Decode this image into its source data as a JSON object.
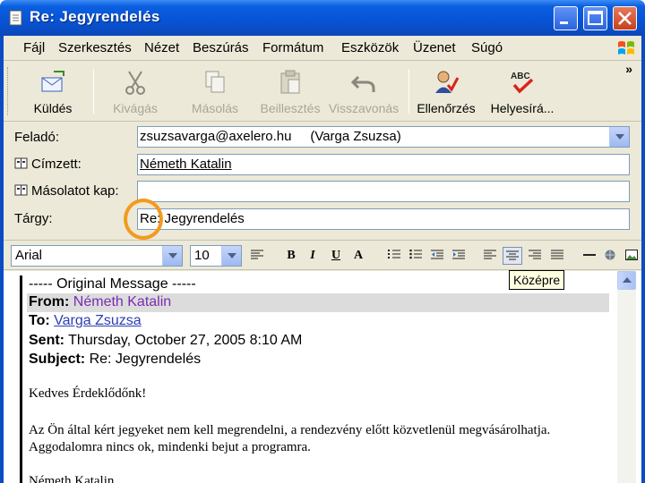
{
  "window": {
    "title": "Re: Jegyrendelés"
  },
  "menu": [
    "Fájl",
    "Szerkesztés",
    "Nézet",
    "Beszúrás",
    "Formátum",
    "Eszközök",
    "Üzenet",
    "Súgó"
  ],
  "toolbar": {
    "send": "Küldés",
    "cut": "Kivágás",
    "copy": "Másolás",
    "paste": "Beillesztés",
    "undo": "Visszavonás",
    "check": "Ellenőrzés",
    "spelling": "Helyesírá...",
    "more": "»"
  },
  "header": {
    "from_label": "Feladó:",
    "from_value": "zsuzsavarga@axelero.hu     (Varga Zsuzsa)",
    "to_label": "Címzett:",
    "to_value": "Németh Katalin",
    "cc_label": "Másolatot kap:",
    "cc_value": "",
    "subject_label": "Tárgy:",
    "subject_value": "Re: Jegyrendelés"
  },
  "format": {
    "font": "Arial",
    "size": "10",
    "bold": "B",
    "italic": "I",
    "underline": "U",
    "font_color": "A",
    "tooltip": "Középre"
  },
  "message": {
    "original_header": "----- Original Message -----",
    "from_label": "From:",
    "from_value": "Németh Katalin",
    "to_label": "To:",
    "to_value": "Varga Zsuzsa",
    "sent_label": "Sent:",
    "sent_value": "Thursday, October 27, 2005 8:10 AM",
    "subject_label": "Subject:",
    "subject_value": "Re: Jegyrendelés",
    "greeting": "Kedves Érdeklődőnk!",
    "line1": "Az Ön által kért jegyeket nem kell megrendelni, a rendezvény előtt közvetlenül megvásárolhatja.",
    "line2": "Aggodalomra nincs ok, mindenki bejut a programra.",
    "signature": "Németh Katalin"
  },
  "colors": {
    "title_bar": "#0754d6",
    "highlight_circle": "#f39a1e",
    "link": "#7a2bb3"
  }
}
